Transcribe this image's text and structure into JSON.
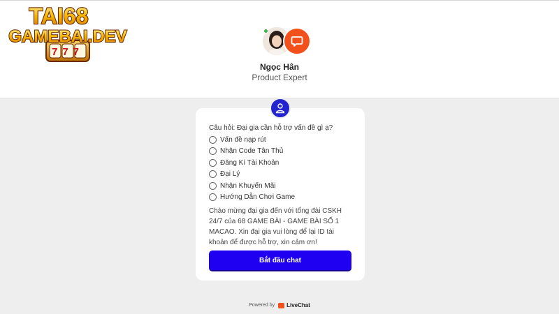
{
  "logo": {
    "line1": "TAI68",
    "line2": "GAMEBAI.DEV",
    "slot_digits": "777",
    "colors": {
      "gold": "#f7b500",
      "outline": "#6b2a00"
    }
  },
  "agent": {
    "name": "Ngọc Hân",
    "role": "Product Expert",
    "status_color": "#3cb54a",
    "bubble_color": "#f2511b"
  },
  "form": {
    "icon": "user-icon",
    "question": "Câu hỏi: Đại gia cần hỗ trợ vấn đề gì ạ?",
    "options": [
      "Vấn đề nạp rút",
      "Nhận Code Tân Thủ",
      "Đăng Kí Tài Khoản",
      "Đại Lý",
      "Nhận Khuyến Mãi",
      "Hướng Dẫn Chơi Game"
    ],
    "welcome": "Chào mừng đại gia đến với tổng đài CSKH 24/7 của 68 GAME BÀI - GAME BÀI SỐ 1 MACAO. Xin đại gia vui lòng để lại ID tài khoản để được hỗ trợ, xin cảm ơn!",
    "start_label": "Bắt đầu chat",
    "accent": "#1f00f0"
  },
  "footer": {
    "powered_by": "Powered by",
    "brand": "LiveChat"
  }
}
